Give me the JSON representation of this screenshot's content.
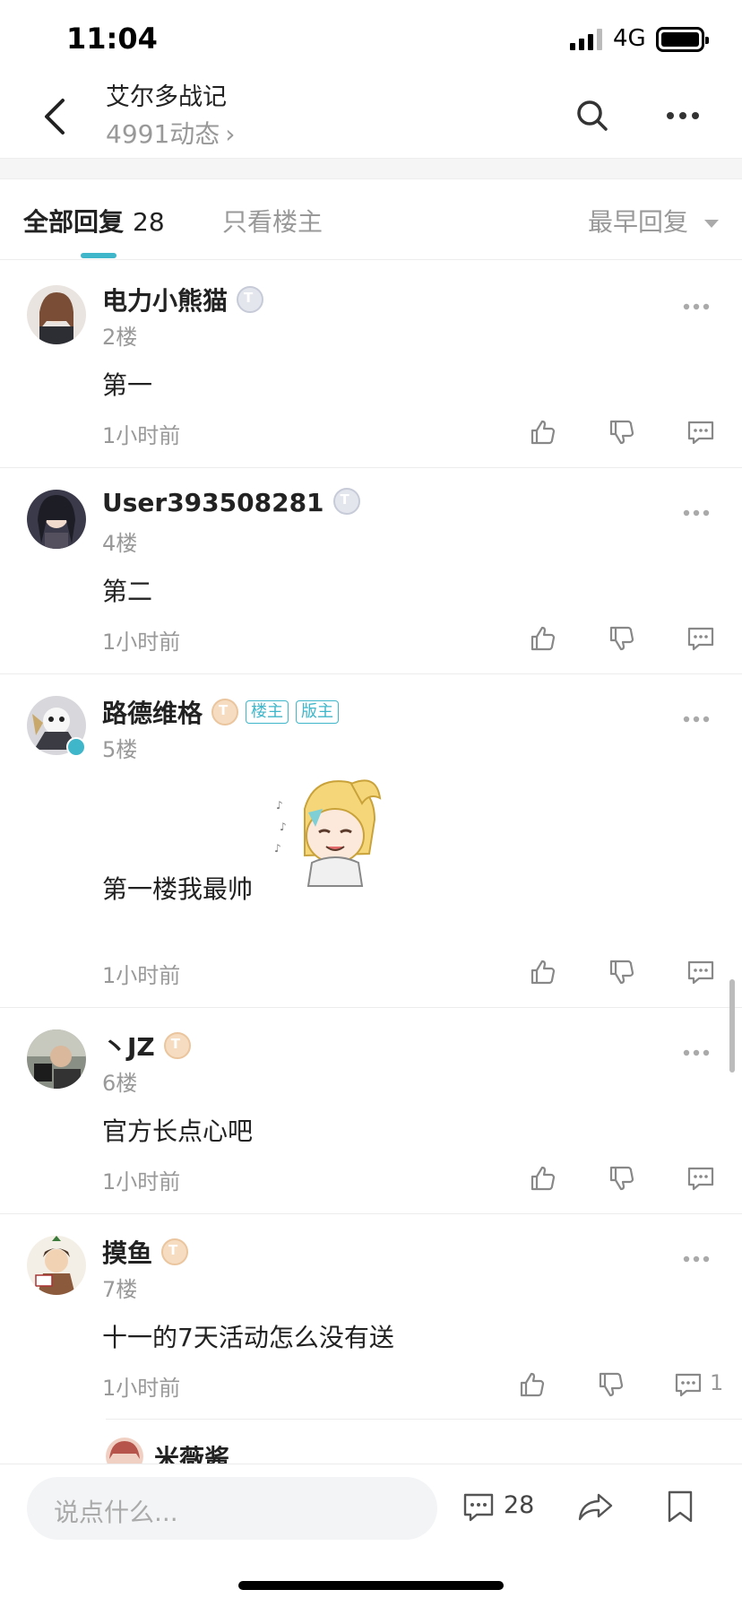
{
  "status": {
    "time": "11:04",
    "network": "4G"
  },
  "header": {
    "title": "艾尔多战记",
    "subtitle": "4991动态"
  },
  "tabs": {
    "all_label": "全部回复",
    "all_count": "28",
    "owner_label": "只看楼主",
    "sort_label": "最早回复"
  },
  "comments": [
    {
      "user": "电力小熊猫",
      "level": "T",
      "floor": "2楼",
      "text": "第一",
      "time": "1小时前"
    },
    {
      "user": "User393508281",
      "level": "T",
      "floor": "4楼",
      "text": "第二",
      "time": "1小时前"
    },
    {
      "user": "路德维格",
      "level": "T",
      "badges": [
        "楼主",
        "版主"
      ],
      "floor": "5楼",
      "text": "第一楼我最帅",
      "time": "1小时前"
    },
    {
      "user": "丶JZ",
      "level": "T",
      "floor": "6楼",
      "text": "官方长点心吧",
      "time": "1小时前"
    },
    {
      "user": "摸鱼",
      "level": "T",
      "floor": "7楼",
      "text": "十一的7天活动怎么没有送",
      "time": "1小时前",
      "reply_count": "1"
    }
  ],
  "subreply": {
    "user": "米薇酱"
  },
  "bottom": {
    "placeholder": "说点什么...",
    "comment_count": "28"
  },
  "colors": {
    "accent": "#3fb6c9",
    "muted": "#999999",
    "text": "#222222"
  }
}
